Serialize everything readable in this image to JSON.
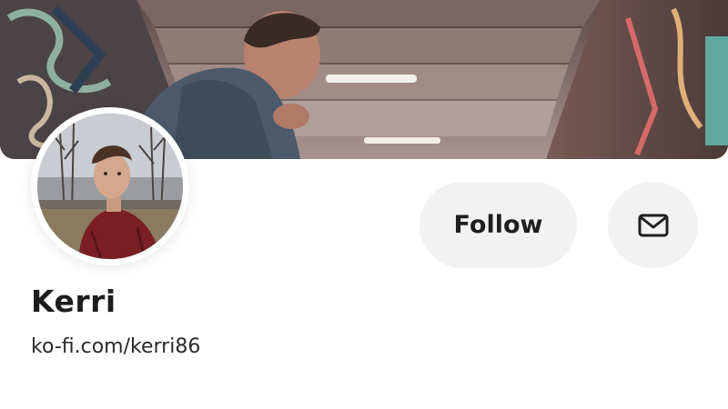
{
  "profile": {
    "name": "Kerri",
    "url": "ko-fi.com/kerri86"
  },
  "actions": {
    "follow_label": "Follow",
    "message_icon": "mail-icon"
  },
  "colors": {
    "button_bg": "#f2f2f2",
    "text": "#1d1d1f",
    "background": "#ffffff"
  }
}
